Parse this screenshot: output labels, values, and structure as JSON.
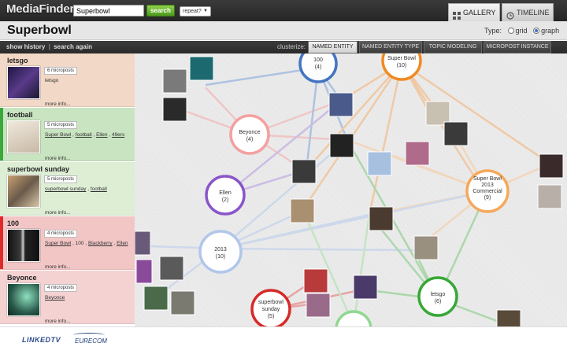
{
  "header": {
    "logo": "MediaFinder",
    "search_value": "Superbowl",
    "search_button": "search",
    "repeat_select": "repeat?",
    "tabs": [
      {
        "label": "GALLERY",
        "icon": "grid-icon",
        "active": true
      },
      {
        "label": "TIMELINE",
        "icon": "clock-icon",
        "active": false
      }
    ]
  },
  "title": {
    "text": "Superbowl",
    "type_label": "Type:",
    "type_options": [
      {
        "label": "grid",
        "selected": false
      },
      {
        "label": "graph",
        "selected": true
      }
    ]
  },
  "toolbar": {
    "show_history": "show history",
    "separator": "|",
    "search_again": "search again",
    "clusterize_label": "clusterize:",
    "cluster_tabs": [
      {
        "label": "NAMED ENTITY",
        "active": true
      },
      {
        "label": "NAMED ENTITY TYPE",
        "active": false
      },
      {
        "label": "TOPIC MODELING",
        "active": false
      },
      {
        "label": "MICROPOST INSTANCE",
        "active": false
      }
    ]
  },
  "sidebar": {
    "items": [
      {
        "name": "letsgo",
        "count": "6 microposts",
        "tags": [
          "letsgo"
        ],
        "more": "more info...",
        "color": "#f2d3bf",
        "bar": "#f2d3bf",
        "thumb": "#3b2a55"
      },
      {
        "name": "football",
        "count": "5 microposts",
        "tags": [
          "Super Bowl",
          "football",
          "Ellen",
          "49ers"
        ],
        "more": "more info...",
        "color": "#c6e3bd",
        "bar": "#3aa83a",
        "thumb": "#c9b9a6"
      },
      {
        "name": "superbowl sunday",
        "count": "5 microposts",
        "tags": [
          "superbowl sunday",
          "football"
        ],
        "more": "more info...",
        "color": "#dcedd3",
        "bar": "#dcedd3",
        "thumb": "#7a6a52"
      },
      {
        "name": "100",
        "count": "4 microposts",
        "tags": [
          "Super Bowl",
          "100",
          "Blackberry",
          "Ellen"
        ],
        "more": "more info...",
        "color": "#f4c6c6",
        "bar": "#e02a2a",
        "thumb": "#222"
      },
      {
        "name": "Beyonce",
        "count": "4 microposts",
        "tags": [
          "Beyonce"
        ],
        "more": "more info...",
        "color": "#f5d0d0",
        "bar": "#f5d0d0",
        "thumb": "#3a6a5a"
      }
    ]
  },
  "graph": {
    "nodes": [
      {
        "label": "100",
        "sub": "(4)",
        "color": "#3b6fc0",
        "fill": "#ffffff"
      },
      {
        "label": "Super Bowl",
        "sub": "(10)",
        "color": "#f08a22",
        "fill": "#ffffff"
      },
      {
        "label": "Beyonce",
        "sub": "(4)",
        "color": "#f08a8a",
        "fill": "#ffffff"
      },
      {
        "label": "Ellen",
        "sub": "(2)",
        "color": "#8a55c8",
        "fill": "#ffffff"
      },
      {
        "label": "2013",
        "sub": "(10)",
        "color": "#a8c0e8",
        "fill": "#ffffff"
      },
      {
        "label": "superbowl sunday",
        "sub": "(5)",
        "color": "#d62a2a",
        "fill": "#ffffff"
      },
      {
        "label": "letsgo",
        "sub": "(6)",
        "color": "#36a836",
        "fill": "#ffffff"
      },
      {
        "label": "Super Bowl 2013 Commercial",
        "sub": "(9)",
        "color": "#f5a85a",
        "fill": "#ffffff"
      },
      {
        "label": "",
        "sub": "",
        "color": "#8fd88f",
        "fill": "#ffffff"
      }
    ]
  },
  "footer": {
    "logo1": "LINKEDTV",
    "logo2": "EURECOM"
  }
}
